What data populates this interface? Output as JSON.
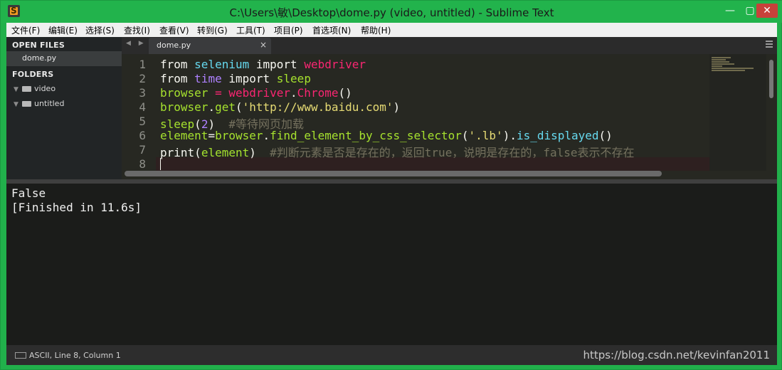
{
  "window": {
    "title": "C:\\Users\\敏\\Desktop\\dome.py (video, untitled) - Sublime Text",
    "minimize": "—",
    "maximize": "▢",
    "close": "✕"
  },
  "menu": [
    "文件(F)",
    "编辑(E)",
    "选择(S)",
    "查找(I)",
    "查看(V)",
    "转到(G)",
    "工具(T)",
    "项目(P)",
    "首选项(N)",
    "帮助(H)"
  ],
  "sidebar": {
    "open_files_header": "OPEN FILES",
    "open_file": "dome.py",
    "folders_header": "FOLDERS",
    "folders": [
      "video",
      "untitled"
    ]
  },
  "tabs": {
    "nav": "◀ ▶",
    "active": "dome.py",
    "close": "×"
  },
  "editor": {
    "line_numbers": [
      "1",
      "2",
      "3",
      "4",
      "5",
      "6",
      "7",
      "8"
    ],
    "lines": [
      [
        [
          "from ",
          "kw"
        ],
        [
          "selenium ",
          "mod"
        ],
        [
          "import ",
          "imp"
        ],
        [
          "webdriver",
          "red"
        ]
      ],
      [
        [
          "from ",
          "kw"
        ],
        [
          "time ",
          "num"
        ],
        [
          "import ",
          "imp"
        ],
        [
          "sleep",
          "grn"
        ]
      ],
      [
        [
          "browser ",
          "grn"
        ],
        [
          "= ",
          "red"
        ],
        [
          "webdriver",
          "red"
        ],
        [
          ".",
          "wht"
        ],
        [
          "Chrome",
          "red"
        ],
        [
          "()",
          "wht"
        ]
      ],
      [
        [
          "browser",
          "grn"
        ],
        [
          ".",
          "wht"
        ],
        [
          "get",
          "grn"
        ],
        [
          "(",
          "wht"
        ],
        [
          "'http://www.baidu.com'",
          "str"
        ],
        [
          ")",
          "wht"
        ]
      ],
      [
        [
          "sleep",
          "grn"
        ],
        [
          "(",
          "wht"
        ],
        [
          "2",
          "num"
        ],
        [
          ")  ",
          "wht"
        ],
        [
          "#等待网页加载",
          "cmt"
        ]
      ],
      [
        [
          "element",
          "grn"
        ],
        [
          "=",
          "wht"
        ],
        [
          "browser",
          "grn"
        ],
        [
          ".",
          "wht"
        ],
        [
          "find_element_by_css_selector",
          "grn"
        ],
        [
          "(",
          "wht"
        ],
        [
          "'.lb'",
          "str"
        ],
        [
          ").",
          "wht"
        ],
        [
          "is_displayed",
          "cyan"
        ],
        [
          "()",
          "wht"
        ]
      ],
      [
        [
          "print",
          "wht"
        ],
        [
          "(",
          "wht"
        ],
        [
          "element",
          "grn"
        ],
        [
          ")  ",
          "wht"
        ],
        [
          "#判断元素是否是存在的，返回true，说明是存在的，false表示不存在",
          "cmt"
        ]
      ],
      [
        [
          "",
          "wht"
        ]
      ]
    ]
  },
  "output": {
    "lines": [
      "False",
      "[Finished in 11.6s]"
    ]
  },
  "status": {
    "text": "ASCII, Line 8, Column 1",
    "watermark": "https://blog.csdn.net/kevinfan2011"
  }
}
